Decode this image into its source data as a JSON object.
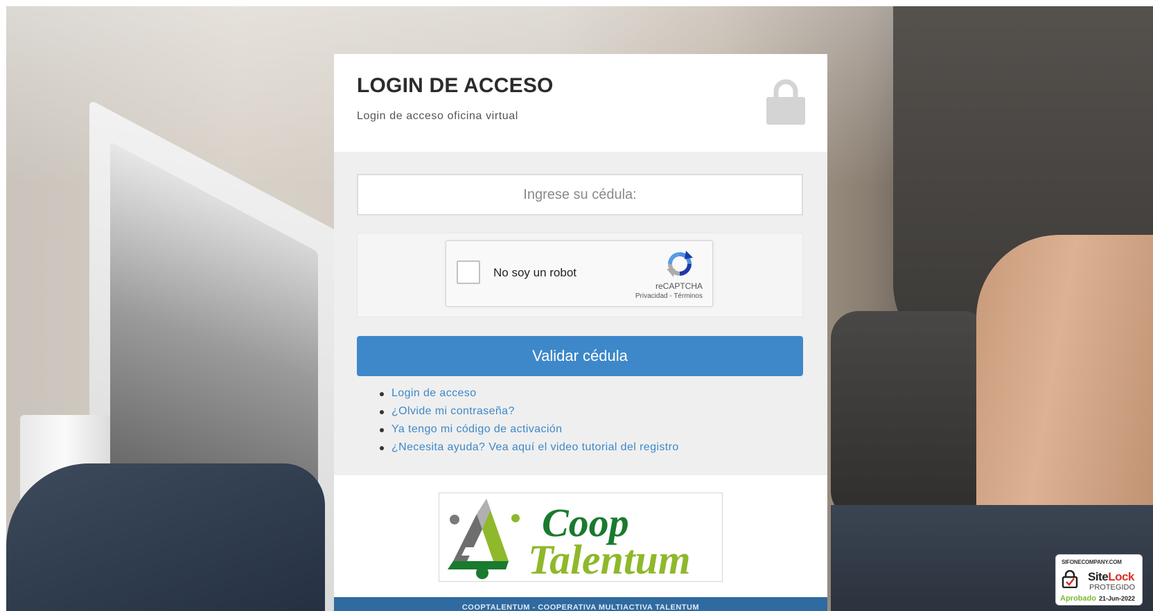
{
  "header": {
    "title": "LOGIN DE ACCESO",
    "subtitle": "Login de acceso oficina virtual",
    "icon": "lock-icon"
  },
  "form": {
    "cedula_placeholder": "Ingrese su cédula:",
    "cedula_value": "",
    "submit_label": "Validar cédula"
  },
  "recaptcha": {
    "label": "No soy un robot",
    "brand": "reCAPTCHA",
    "privacy": "Privacidad",
    "separator": " - ",
    "terms": "Términos",
    "checked": false
  },
  "links": [
    "Login de acceso",
    "¿Olvide mi contraseña?",
    "Ya tengo mi código de activación",
    "¿Necesita ayuda? Vea aquí el video tutorial del registro"
  ],
  "logo": {
    "line1": "Coop",
    "line2": "Talentum"
  },
  "footer": {
    "text": "COOPTALENTUM - COOPERATIVA MULTIACTIVA TALENTUM"
  },
  "sitelock": {
    "site": "SIFONECOMPANY.COM",
    "brand_site": "Site",
    "brand_lock": "Lock",
    "status": "PROTEGIDO",
    "approved": "Aprobado",
    "date": "21-Jun-2022"
  },
  "colors": {
    "accent": "#3e88c9",
    "footer": "#2f6aa0",
    "logo_green": "#1a7a2e",
    "logo_lime": "#8fb82b"
  }
}
